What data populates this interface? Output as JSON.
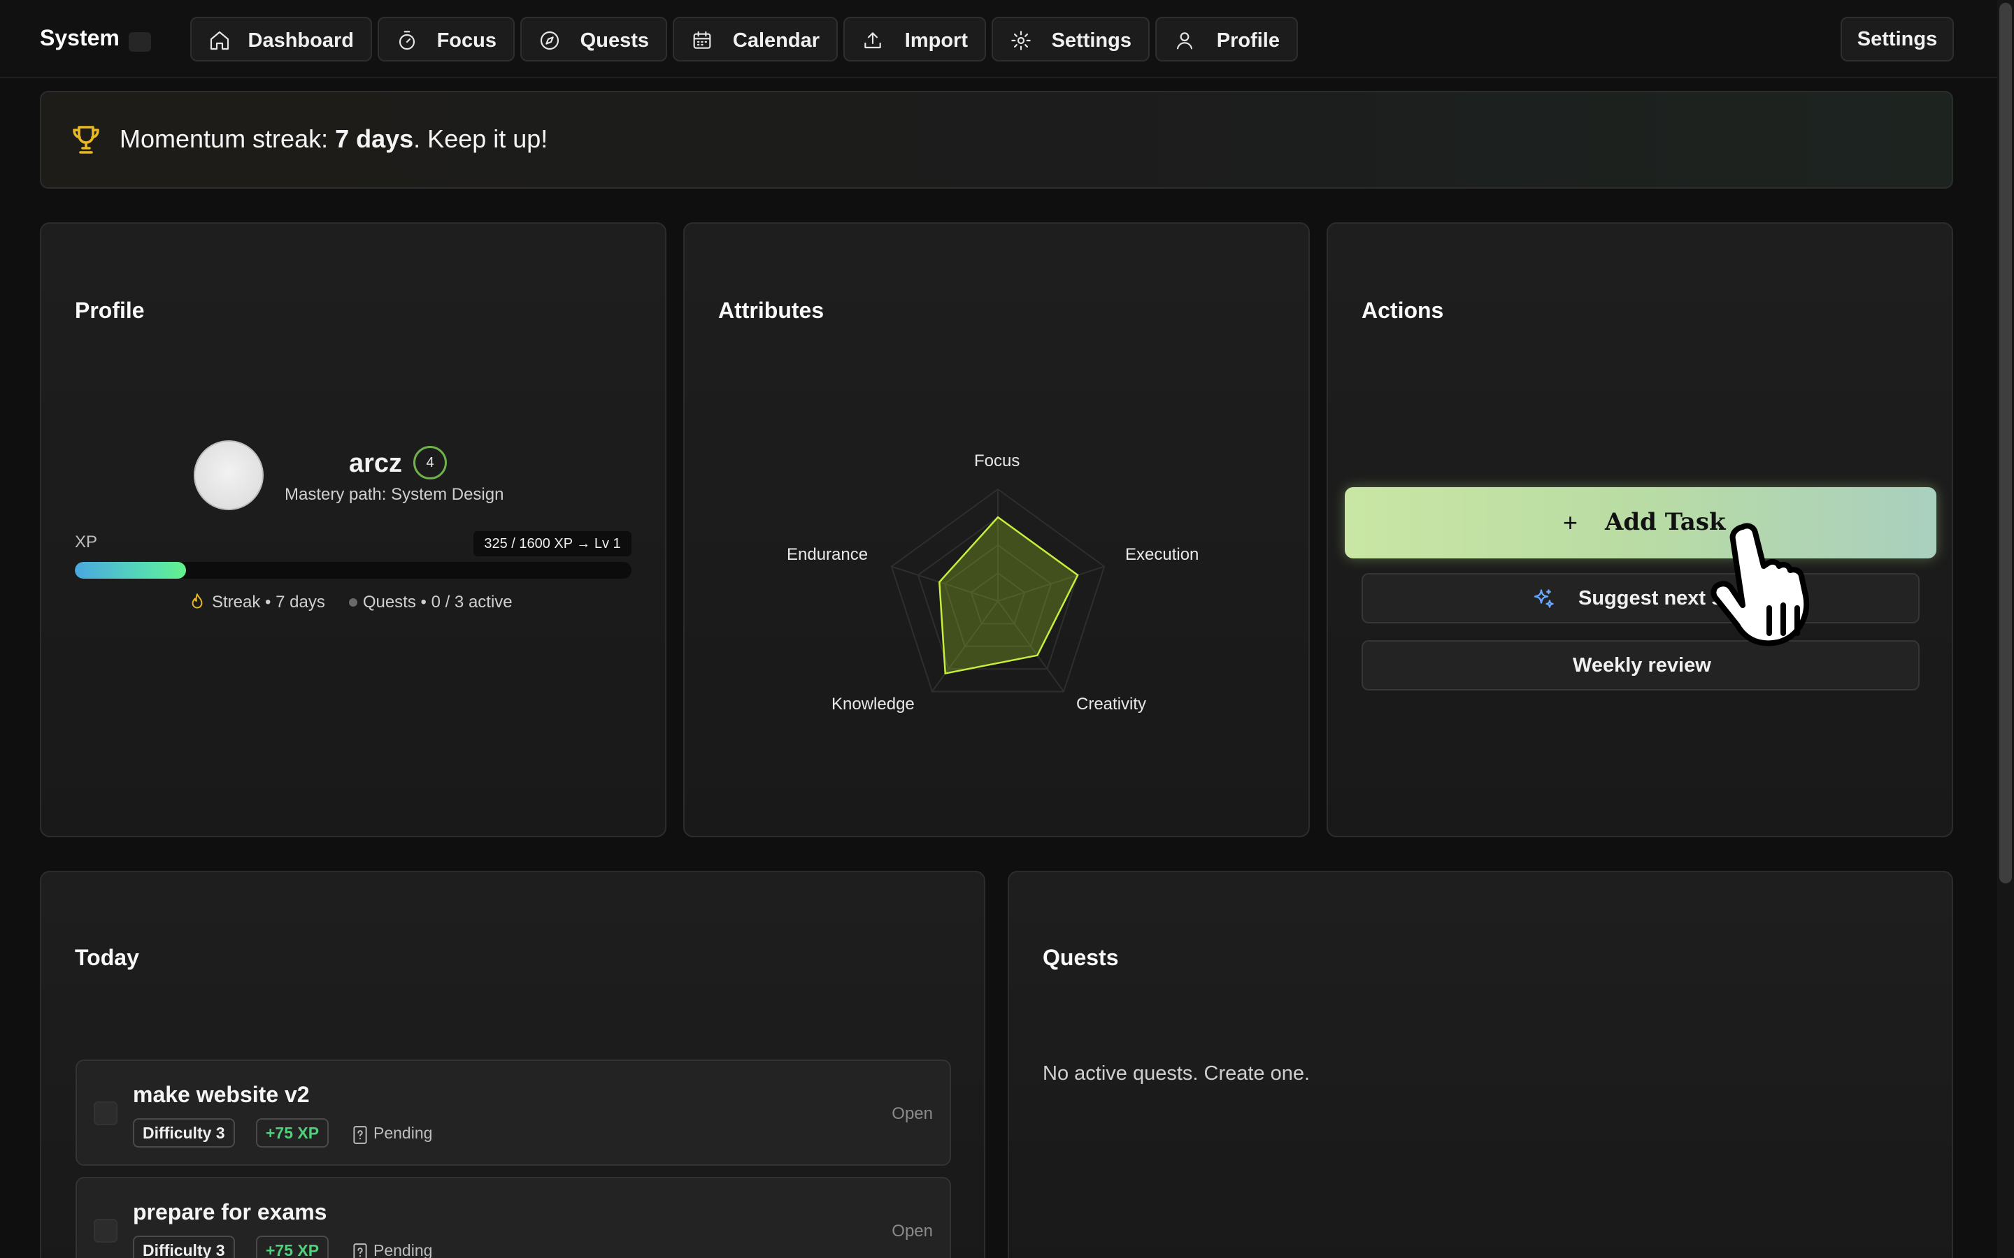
{
  "brand": "System",
  "nav": [
    {
      "label": "Dashboard",
      "icon": "home-icon"
    },
    {
      "label": "Focus",
      "icon": "timer-icon"
    },
    {
      "label": "Quests",
      "icon": "compass-icon"
    },
    {
      "label": "Calendar",
      "icon": "calendar-icon"
    },
    {
      "label": "Import",
      "icon": "upload-icon"
    },
    {
      "label": "Settings",
      "icon": "gear-icon"
    },
    {
      "label": "Profile",
      "icon": "user-icon"
    }
  ],
  "top_right_settings": "Settings",
  "banner": {
    "prefix": "Momentum streak: ",
    "highlight": "7 days",
    "suffix": ". Keep it up!"
  },
  "profile": {
    "title": "Profile",
    "username": "arcz",
    "level": "4",
    "mastery": "Mastery path: System Design",
    "xp_label": "XP",
    "xp_chip": "325 / 1600 XP → Lv 1",
    "xp_fraction": 0.2,
    "streak": "Streak • 7 days",
    "quests": "Quests • 0 / 3 active"
  },
  "attributes": {
    "title": "Attributes",
    "labels": [
      "Focus",
      "Execution",
      "Creativity",
      "Knowledge",
      "Endurance"
    ],
    "values": [
      0.75,
      0.75,
      0.6,
      0.8,
      0.55
    ]
  },
  "actions": {
    "title": "Actions",
    "add_task": "Add Task",
    "suggest": "Suggest next s",
    "weekly": "Weekly review"
  },
  "today": {
    "title": "Today",
    "tasks": [
      {
        "title": "make website v2",
        "difficulty": "Difficulty 3",
        "xp": "+75 XP",
        "status": "Pending",
        "action": "Open"
      },
      {
        "title": "prepare for exams",
        "difficulty": "Difficulty 3",
        "xp": "+75 XP",
        "status": "Pending",
        "action": "Open"
      }
    ]
  },
  "quests": {
    "title": "Quests",
    "empty": "No active quests. Create one."
  },
  "colors": {
    "accent_green": "#4fd07a",
    "trophy": "#e8b923",
    "radar": "#c6ee3c"
  }
}
